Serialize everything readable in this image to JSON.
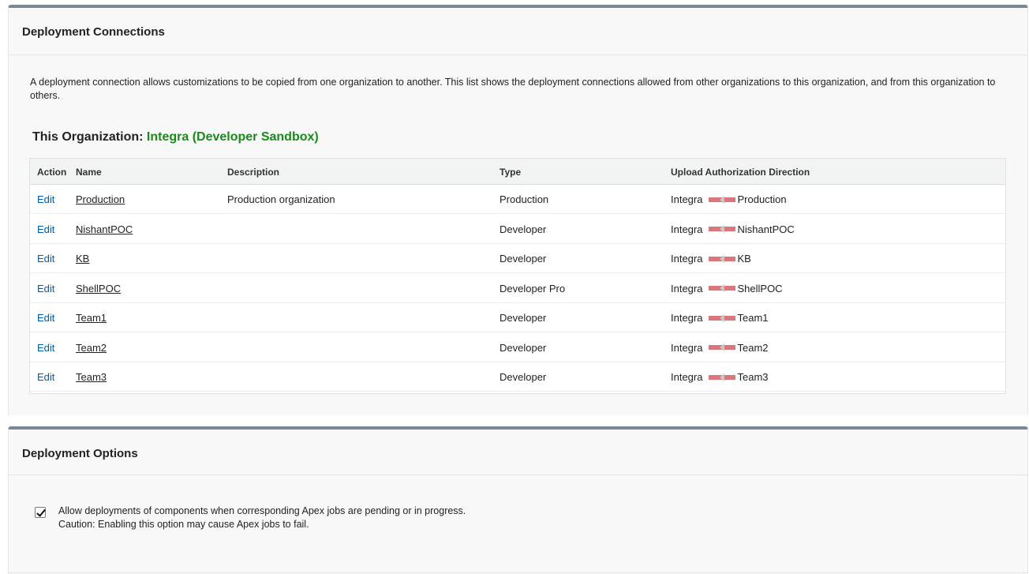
{
  "connections_panel": {
    "title": "Deployment Connections",
    "description": "A deployment connection allows customizations to be copied from one organization to another. This list shows the deployment connections allowed from other organizations to this organization, and from this organization to others.",
    "org_label": "This Organization:",
    "org_name": "Integra (Developer Sandbox)",
    "table": {
      "headers": {
        "action": "Action",
        "name": "Name",
        "description": "Description",
        "type": "Type",
        "direction": "Upload Authorization Direction"
      },
      "rows": [
        {
          "action": "Edit",
          "name": "Production",
          "description": "Production organization",
          "type": "Production",
          "from": "Integra",
          "to": "Production"
        },
        {
          "action": "Edit",
          "name": "NishantPOC",
          "description": "",
          "type": "Developer",
          "from": "Integra",
          "to": "NishantPOC"
        },
        {
          "action": "Edit",
          "name": "KB",
          "description": "",
          "type": "Developer",
          "from": "Integra",
          "to": "KB"
        },
        {
          "action": "Edit",
          "name": "ShellPOC",
          "description": "",
          "type": "Developer Pro",
          "from": "Integra",
          "to": "ShellPOC"
        },
        {
          "action": "Edit",
          "name": "Team1",
          "description": "",
          "type": "Developer",
          "from": "Integra",
          "to": "Team1"
        },
        {
          "action": "Edit",
          "name": "Team2",
          "description": "",
          "type": "Developer",
          "from": "Integra",
          "to": "Team2"
        },
        {
          "action": "Edit",
          "name": "Team3",
          "description": "",
          "type": "Developer",
          "from": "Integra",
          "to": "Team3"
        }
      ]
    }
  },
  "options_panel": {
    "title": "Deployment Options",
    "option": {
      "checked": true,
      "label": "Allow deployments of components when corresponding Apex jobs are pending or in progress.",
      "caution": "Caution: Enabling this option may cause Apex jobs to fail."
    }
  },
  "colors": {
    "accent_green": "#1b8a1b",
    "link_blue": "#015ba7",
    "arrow_red": "#d9777a",
    "panel_border": "#7a8796"
  }
}
